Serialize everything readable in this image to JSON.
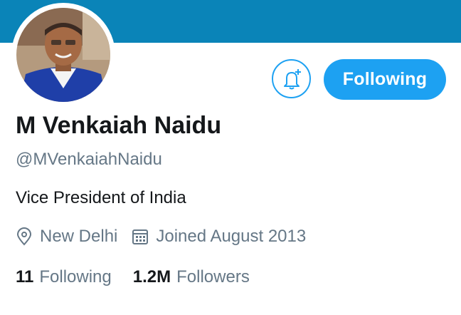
{
  "profile": {
    "name": "M Venkaiah Naidu",
    "handle": "@MVenkaiahNaidu",
    "bio": "Vice President of India",
    "location": "New Delhi",
    "joined": "Joined August 2013"
  },
  "actions": {
    "notify_icon": "bell-plus-icon",
    "follow_label": "Following"
  },
  "stats": {
    "following_count": "11",
    "following_label": "Following",
    "followers_count": "1.2M",
    "followers_label": "Followers"
  },
  "colors": {
    "banner": "#0a84b8",
    "accent": "#1da1f2",
    "text_primary": "#14171a",
    "text_secondary": "#657786"
  }
}
